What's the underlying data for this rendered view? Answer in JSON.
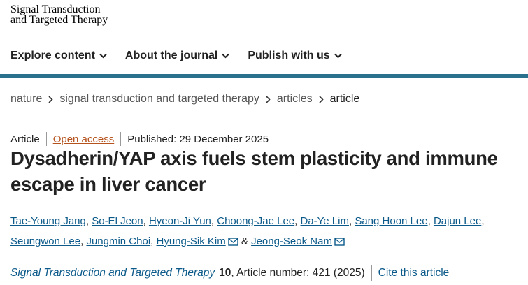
{
  "header": {
    "logo_line1": "Signal Transduction",
    "logo_line2": "and Targeted Therapy"
  },
  "nav": [
    {
      "label": "Explore content"
    },
    {
      "label": "About the journal"
    },
    {
      "label": "Publish with us"
    }
  ],
  "breadcrumb": {
    "items": [
      "nature",
      "signal transduction and targeted therapy",
      "articles"
    ],
    "current": "article"
  },
  "article": {
    "type": "Article",
    "access": "Open access",
    "published": "Published: 29 December 2025",
    "title_line1": "Dysadherin/YAP axis fuels stem plasticity and immune",
    "title_line2": "escape in liver cancer"
  },
  "authors": [
    "Tae-Young Jang",
    "So-El Jeon",
    "Hyeon-Ji Yun",
    "Choong-Jae Lee",
    "Da-Ye Lim",
    "Sang Hoon Lee",
    "Dajun Lee",
    "Seungwon Lee",
    "Jungmin Choi",
    "Hyung-Sik Kim",
    "Jeong-Seok Nam"
  ],
  "author_sep": ",",
  "author_and": "&",
  "citation": {
    "journal": "Signal Transduction and Targeted Therapy",
    "volume": "10",
    "number": ", Article number: 421 (2025)",
    "cite_link": "Cite this article"
  },
  "icons": {
    "nav_caret": "chevron-down-icon",
    "breadcrumb_sep": "chevron-right-icon",
    "author_contact": "envelope-icon"
  },
  "colors": {
    "accent_rule": "#29718c",
    "link": "#0c5a8a",
    "open_access": "#b5521d"
  }
}
